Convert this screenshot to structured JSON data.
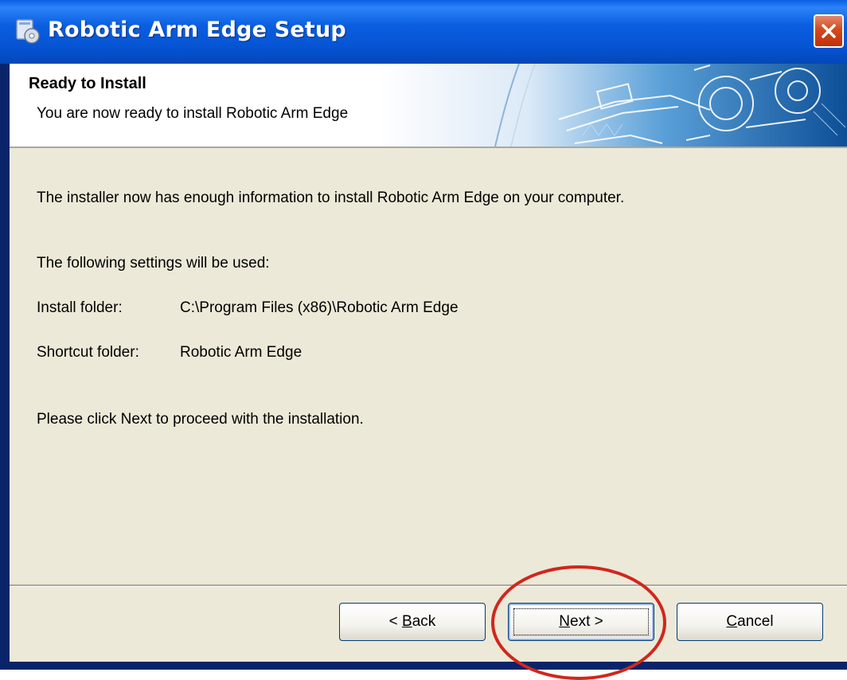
{
  "window": {
    "title": "Robotic Arm Edge Setup",
    "icon": "installer-icon",
    "close_icon": "close-x-icon"
  },
  "header": {
    "title": "Ready to Install",
    "subtitle": "You are now ready to install Robotic Arm Edge",
    "art": "robotic-arm-banner-graphic"
  },
  "body": {
    "intro": "The installer now has enough information to install Robotic Arm Edge on your computer.",
    "settings_heading": "The following settings will be used:",
    "install_folder_label": "Install folder:",
    "install_folder_value": "C:\\Program Files (x86)\\Robotic Arm Edge",
    "shortcut_folder_label": "Shortcut folder:",
    "shortcut_folder_value": "Robotic Arm Edge",
    "instruction": "Please click Next to proceed with the installation."
  },
  "buttons": {
    "back_prefix": "< ",
    "back_hotkey": "B",
    "back_rest": "ack",
    "next_hotkey": "N",
    "next_rest": "ext >",
    "cancel_hotkey": "C",
    "cancel_rest": "ancel"
  },
  "colors": {
    "titlebar": "#0553d2",
    "dialog_bg": "#ece9d8",
    "close_button": "#d3491c",
    "annotation_circle": "#d0271d"
  }
}
